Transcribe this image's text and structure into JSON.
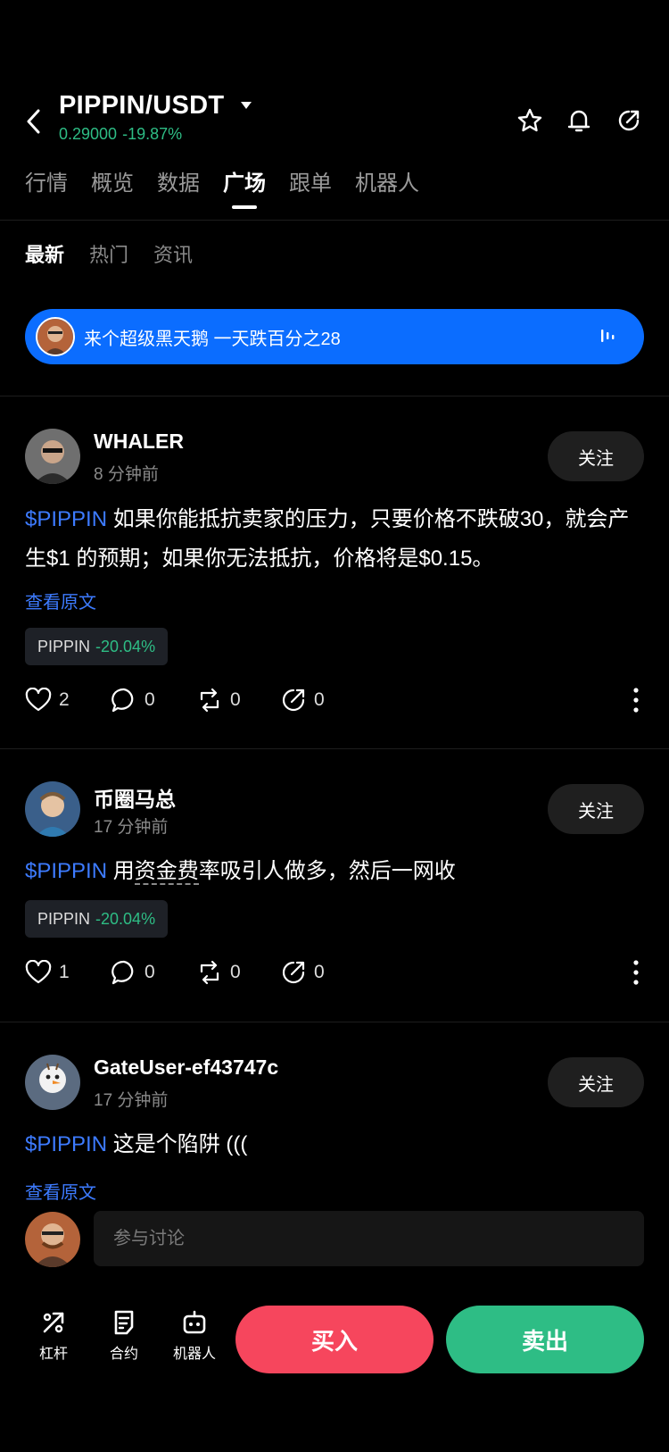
{
  "header": {
    "pair": "PIPPIN/USDT",
    "price": "0.29000",
    "change": "-19.87%"
  },
  "main_tabs": [
    {
      "label": "行情"
    },
    {
      "label": "概览"
    },
    {
      "label": "数据"
    },
    {
      "label": "广场"
    },
    {
      "label": "跟单"
    },
    {
      "label": "机器人"
    }
  ],
  "active_main_tab": "广场",
  "sub_tabs": [
    {
      "label": "最新"
    },
    {
      "label": "热门"
    },
    {
      "label": "资讯"
    }
  ],
  "banner": {
    "text": "来个超级黑天鹅 一天跌百分之28"
  },
  "posts": [
    {
      "username": "WHALER",
      "time": "8 分钟前",
      "follow_label": "关注",
      "tag": "$PIPPIN",
      "text": " 如果你能抵抗卖家的压力，只要价格不跌破30，就会产生$1 的预期；如果你无法抵抗，价格将是$0.15。",
      "view_original": "查看原文",
      "chip_symbol": "PIPPIN",
      "chip_change": "-20.04%",
      "likes": "2",
      "comments": "0",
      "reposts": "0",
      "shares": "0"
    },
    {
      "username": "币圈马总",
      "time": "17 分钟前",
      "follow_label": "关注",
      "tag": "$PIPPIN",
      "text_before": " 用",
      "text_underlined": "资金费",
      "text_after": "率吸引人做多，然后一网收",
      "chip_symbol": "PIPPIN",
      "chip_change": "-20.04%",
      "likes": "1",
      "comments": "0",
      "reposts": "0",
      "shares": "0"
    },
    {
      "username": "GateUser-ef43747c",
      "time": "17 分钟前",
      "follow_label": "关注",
      "tag": "$PIPPIN",
      "text": "  这是个陷阱 (((",
      "view_original": "查看原文"
    }
  ],
  "comment": {
    "placeholder": "参与讨论"
  },
  "bottom": {
    "leverage": "杠杆",
    "contract": "合约",
    "bot": "机器人",
    "buy": "买入",
    "sell": "卖出"
  },
  "colors": {
    "up": "#2ebd85",
    "down": "#f6465d",
    "link": "#3d7bff",
    "banner": "#0b6dff"
  }
}
